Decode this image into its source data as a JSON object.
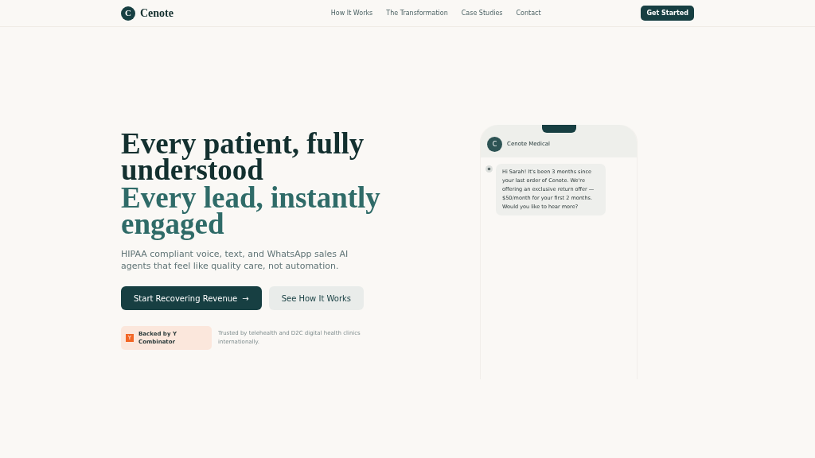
{
  "header": {
    "logo_mark": "C",
    "logo_text": "Cenote",
    "nav": [
      "How It Works",
      "The Transformation",
      "Case Studies",
      "Contact"
    ],
    "cta": "Get Started"
  },
  "hero": {
    "headline_1": "Every patient, fully understood",
    "headline_2": "Every lead, instantly engaged",
    "subtitle": "HIPAA compliant voice, text, and WhatsApp sales AI agents that feel like quality care, not automation.",
    "primary_button": {
      "label": "Start Recovering Revenue",
      "arrow": "→"
    },
    "secondary_button": "See How It Works",
    "badge": {
      "mark": "Y",
      "text": "Backed by Y Combinator"
    },
    "trust_text": "Trusted by telehealth and D2C digital health clinics internationally."
  },
  "phone": {
    "avatar": "C",
    "contact": "Cenote Medical",
    "message": "Hi Sarah! It's been 3 months since your last order of Cenote. We're offering an exclusive return offer — $50/month for your first 2 months. Would you like to hear more?"
  }
}
